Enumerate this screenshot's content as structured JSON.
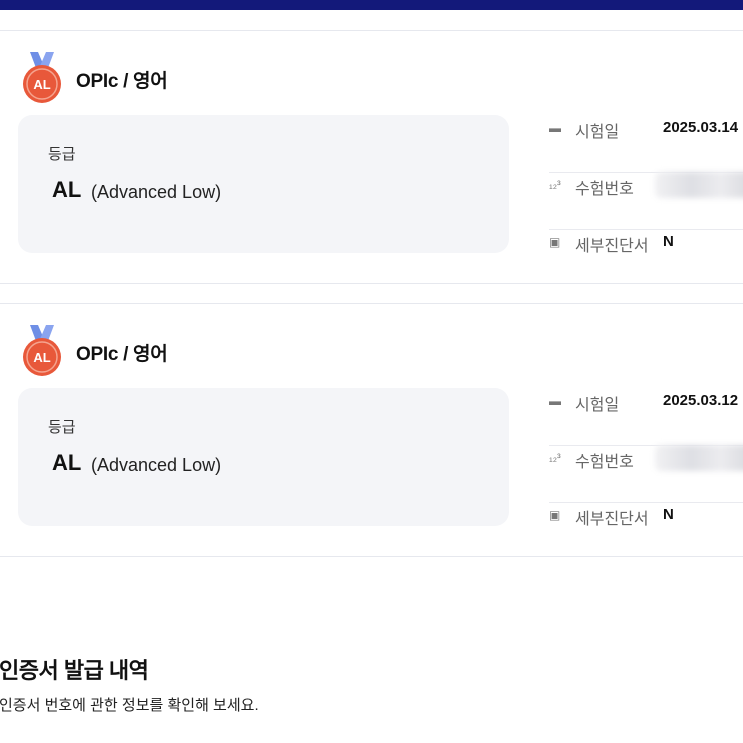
{
  "colors": {
    "top_bar": "#13197a",
    "medal": "#e8583a",
    "ribbon": "#6f8fe6",
    "grade_box": "#f4f5f8"
  },
  "cards": [
    {
      "title": "OPIc / 영어",
      "medal_text": "AL",
      "grade_label": "등급",
      "grade_value": "AL",
      "grade_desc": "(Advanced Low)",
      "info": {
        "date_label": "시험일",
        "date_value": "2025.03.14",
        "exam_no_label": "수험번호",
        "report_label": "세부진단서",
        "report_value": "N"
      }
    },
    {
      "title": "OPIc / 영어",
      "medal_text": "AL",
      "grade_label": "등급",
      "grade_value": "AL",
      "grade_desc": "(Advanced Low)",
      "info": {
        "date_label": "시험일",
        "date_value": "2025.03.12",
        "exam_no_label": "수험번호",
        "report_label": "세부진단서",
        "report_value": "N"
      }
    }
  ],
  "section": {
    "title": "인증서 발급 내역",
    "description": "인증서 번호에 관한 정보를 확인해 보세요."
  },
  "icons": [
    "medal-icon",
    "calendar-icon",
    "number-icon",
    "report-icon"
  ]
}
